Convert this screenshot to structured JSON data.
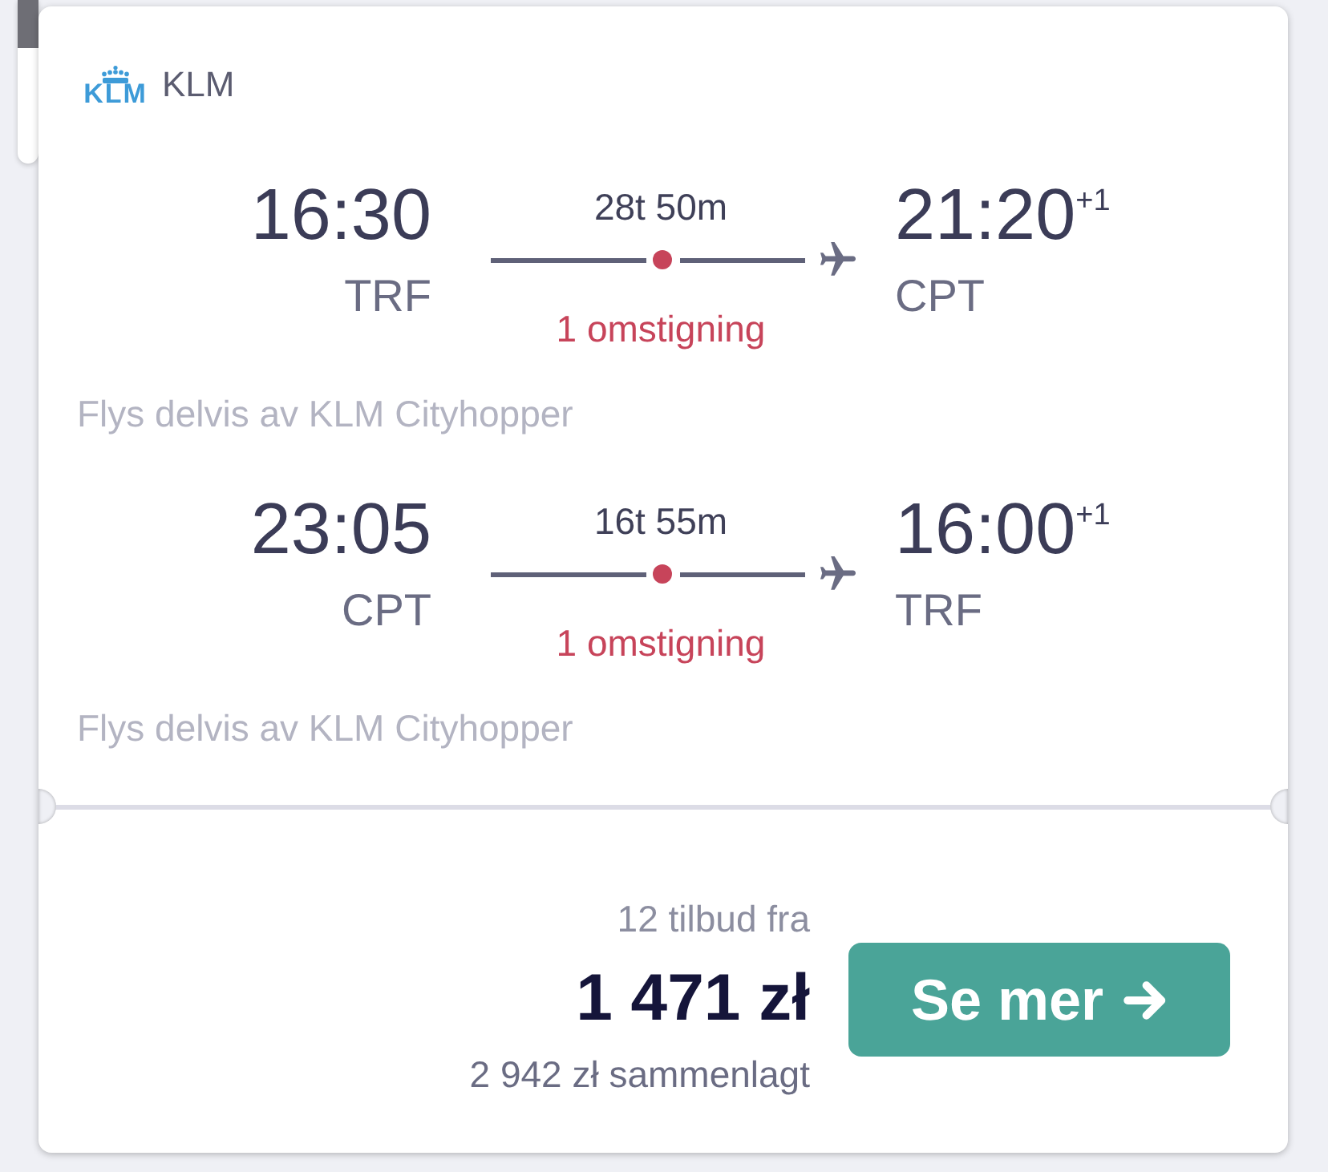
{
  "airline": {
    "logo_text": "KLM",
    "name": "KLM"
  },
  "legs": [
    {
      "departure": {
        "time": "16:30",
        "airport": "TRF"
      },
      "duration": "28t 50m",
      "stops": "1 omstigning",
      "arrival": {
        "time": "21:20",
        "day_offset": "+1",
        "airport": "CPT"
      },
      "operated_by": "Flys delvis av KLM Cityhopper"
    },
    {
      "departure": {
        "time": "23:05",
        "airport": "CPT"
      },
      "duration": "16t 55m",
      "stops": "1 omstigning",
      "arrival": {
        "time": "16:00",
        "day_offset": "+1",
        "airport": "TRF"
      },
      "operated_by": "Flys delvis av KLM Cityhopper"
    }
  ],
  "offer": {
    "deals": "12 tilbud fra",
    "price": "1 471 zł",
    "total": "2 942 zł sammenlagt",
    "button": "Se mer"
  }
}
